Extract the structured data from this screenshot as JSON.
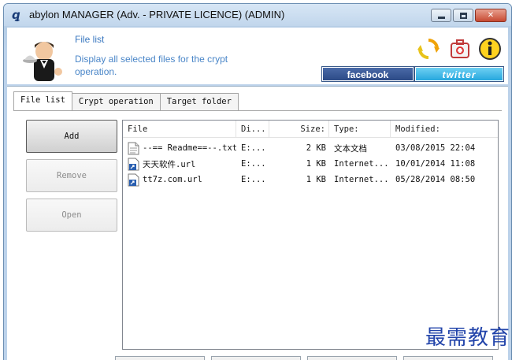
{
  "window": {
    "title": "abylon MANAGER (Adv. - PRIVATE LICENCE) (ADMIN)",
    "minimize_icon": "minimize-icon",
    "maximize_icon": "maximize-icon",
    "close_glyph": "✕"
  },
  "header": {
    "title": "File list",
    "description": "Display all selected files for the crypt operation.",
    "facebook_label": "facebook",
    "twitter_label": "twitter"
  },
  "tabs": [
    {
      "label": "File list",
      "active": true
    },
    {
      "label": "Crypt operation",
      "active": false
    },
    {
      "label": "Target folder",
      "active": false
    }
  ],
  "buttons": {
    "add": "Add",
    "remove": "Remove",
    "open": "Open"
  },
  "list": {
    "columns": [
      "File",
      "Di...",
      "Size:",
      "Type:",
      "Modified:"
    ],
    "rows": [
      {
        "file": "--== Readme==--.txt",
        "dir": "E:...",
        "size": "2 KB",
        "type": "文本文档",
        "modified": "03/08/2015 22:04",
        "icon": "text-file-icon"
      },
      {
        "file": "天天软件.url",
        "dir": "E:...",
        "size": "1 KB",
        "type": "Internet...",
        "modified": "10/01/2014 11:08",
        "icon": "url-file-icon"
      },
      {
        "file": "tt7z.com.url",
        "dir": "E:...",
        "size": "1 KB",
        "type": "Internet...",
        "modified": "05/28/2014 08:50",
        "icon": "url-file-icon"
      }
    ]
  },
  "watermark": "最需教育",
  "colors": {
    "accent": "#3a78c0",
    "facebook": "#2c4a86",
    "twitter": "#26a7de"
  }
}
